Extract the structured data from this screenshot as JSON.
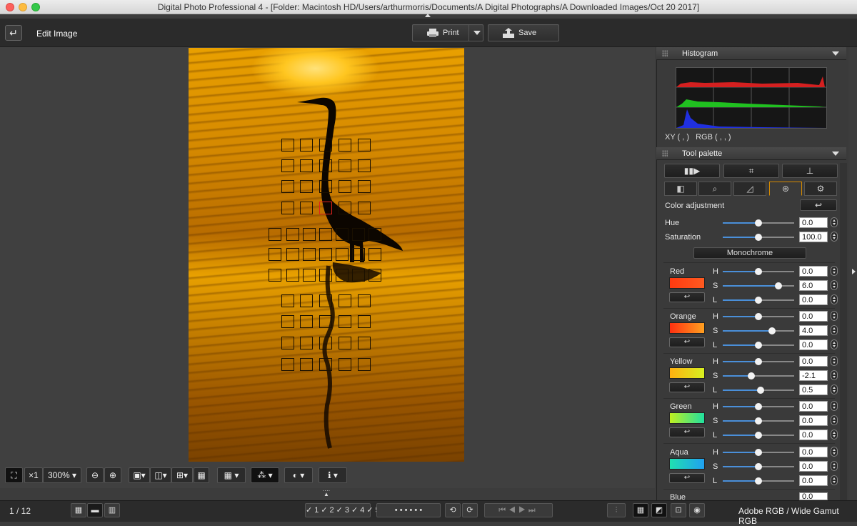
{
  "window": {
    "title": "Digital Photo Professional 4 - [Folder: Macintosh HD/Users/arthurmorris/Documents/A Digital Photographs/A Downloaded Images/Oct 20 2017]"
  },
  "toolbar": {
    "title": "Edit Image",
    "print_label": "Print",
    "save_label": "Save",
    "back_icon": "↵"
  },
  "zoom_bar": {
    "fit_label": "⛶",
    "x1_label": "×1",
    "zoom_value": "300%"
  },
  "histogram": {
    "title": "Histogram",
    "xy_label": "XY (          ,          )",
    "rgb_label": "RGB (          ,          ,          )"
  },
  "tool_palette": {
    "title": "Tool palette",
    "section_title": "Color adjustment",
    "hue_label": "Hue",
    "hue_value": "0.0",
    "saturation_label": "Saturation",
    "saturation_value": "100.0",
    "monochrome_label": "Monochrome",
    "colors": [
      {
        "name": "Red",
        "h": "0.0",
        "s": "6.0",
        "l": "0.0"
      },
      {
        "name": "Orange",
        "h": "0.0",
        "s": "4.0",
        "l": "0.0"
      },
      {
        "name": "Yellow",
        "h": "0.0",
        "s": "-2.1",
        "l": "0.5"
      },
      {
        "name": "Green",
        "h": "0.0",
        "s": "0.0",
        "l": "0.0"
      },
      {
        "name": "Aqua",
        "h": "0.0",
        "s": "0.0",
        "l": "0.0"
      },
      {
        "name": "Blue",
        "h": "0.0"
      }
    ],
    "h_letter": "H",
    "s_letter": "S",
    "l_letter": "L"
  },
  "status": {
    "counter": "1 / 12",
    "color_space": "Adobe RGB / Wide Gamut RGB",
    "dots": "• • • • • •"
  },
  "colors": {
    "accent_tab": "#d58a00",
    "slider_blue": "#4a8fd9",
    "af_selected": "#e0221c"
  }
}
